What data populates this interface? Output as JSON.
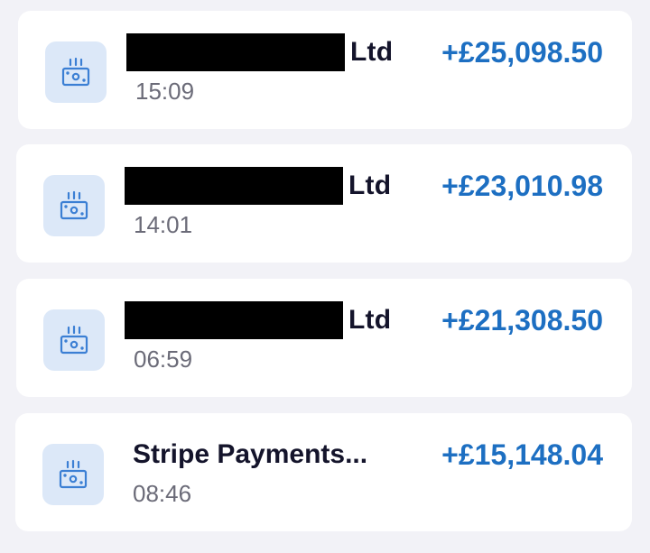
{
  "theme": {
    "accent": "#1d6fc2",
    "icon_background": "#dce8f8",
    "icon_stroke": "#3b7fd4"
  },
  "transactions": [
    {
      "name_redacted": true,
      "name_suffix": "Ltd",
      "amount": "+£25,098.50",
      "time": "15:09",
      "icon": "cash-icon"
    },
    {
      "name_redacted": true,
      "name_suffix": "Ltd",
      "amount": "+£23,010.98",
      "time": "14:01",
      "icon": "cash-icon"
    },
    {
      "name_redacted": true,
      "name_suffix": "Ltd",
      "amount": "+£21,308.50",
      "time": "06:59",
      "icon": "cash-icon"
    },
    {
      "name_redacted": false,
      "name": "Stripe Payments...",
      "amount": "+£15,148.04",
      "time": "08:46",
      "icon": "cash-icon"
    }
  ]
}
